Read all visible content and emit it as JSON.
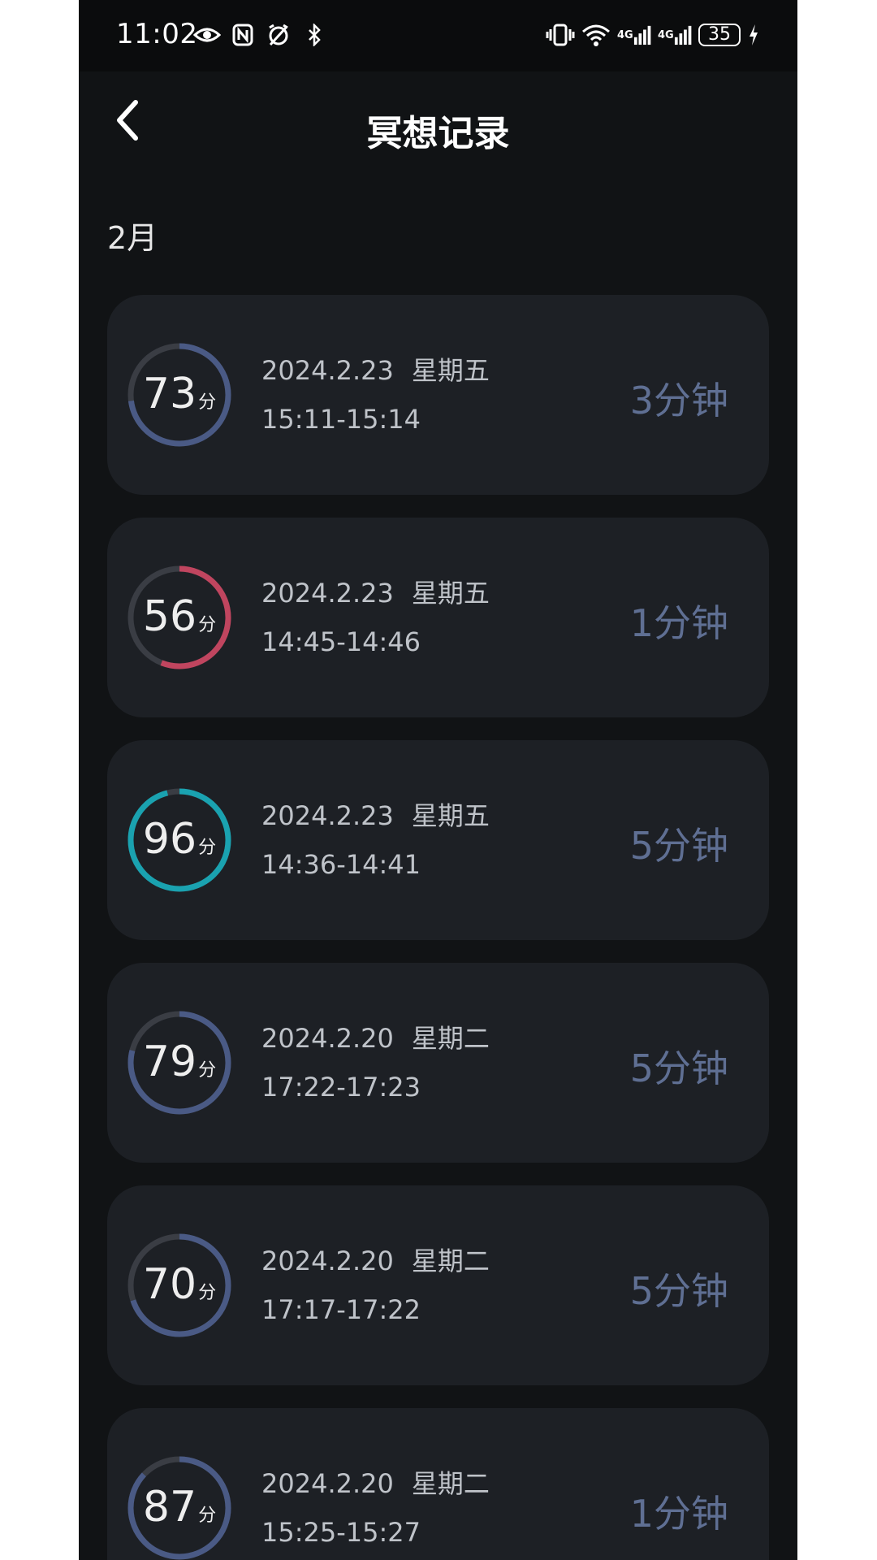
{
  "status_bar": {
    "time": "11:02",
    "net1": "4G",
    "net2": "4G",
    "battery": "35"
  },
  "header": {
    "title": "冥想记录"
  },
  "month": "2月",
  "unit": "分",
  "records": [
    {
      "score": "73",
      "progress": 0.73,
      "color": "#4a5a85",
      "date": "2024.2.23",
      "weekday": "星期五",
      "time_range": "15:11-15:14",
      "duration": "3分钟"
    },
    {
      "score": "56",
      "progress": 0.56,
      "color": "#c0455f",
      "date": "2024.2.23",
      "weekday": "星期五",
      "time_range": "14:45-14:46",
      "duration": "1分钟"
    },
    {
      "score": "96",
      "progress": 0.96,
      "color": "#1aa2b0",
      "date": "2024.2.23",
      "weekday": "星期五",
      "time_range": "14:36-14:41",
      "duration": "5分钟"
    },
    {
      "score": "79",
      "progress": 0.79,
      "color": "#4a5a85",
      "date": "2024.2.20",
      "weekday": "星期二",
      "time_range": "17:22-17:23",
      "duration": "5分钟"
    },
    {
      "score": "70",
      "progress": 0.7,
      "color": "#4a5a85",
      "date": "2024.2.20",
      "weekday": "星期二",
      "time_range": "17:17-17:22",
      "duration": "5分钟"
    },
    {
      "score": "87",
      "progress": 0.87,
      "color": "#4a5a85",
      "date": "2024.2.20",
      "weekday": "星期二",
      "time_range": "15:25-15:27",
      "duration": "1分钟"
    }
  ],
  "colors": {
    "track": "#3a3d44",
    "card": "#1d2025",
    "background": "#111315"
  }
}
